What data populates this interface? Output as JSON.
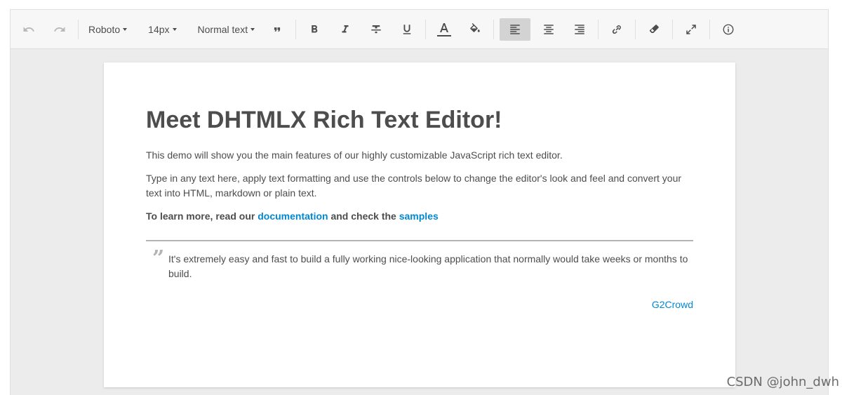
{
  "toolbar": {
    "font_family": "Roboto",
    "font_size": "14px",
    "block_type": "Normal text"
  },
  "document": {
    "title": "Meet DHTMLX Rich Text Editor!",
    "paragraph1": "This demo will show you the main features of our highly customizable JavaScript rich text editor.",
    "paragraph2": "Type in any text here, apply text formatting and use the controls below to change the editor's look and feel and convert your text into HTML, markdown or plain text.",
    "learn_prefix": "To learn more, read our ",
    "learn_link1": "documentation",
    "learn_middle": " and check the ",
    "learn_link2": "samples",
    "quote_text": "It's extremely easy and fast to build a fully working nice-looking application that normally would take weeks or months to build.",
    "quote_author": "G2Crowd"
  },
  "watermark": "CSDN @john_dwh",
  "colors": {
    "link": "#0288d1",
    "text": "#4d4d4d",
    "active_button": "#d3d3d3"
  }
}
